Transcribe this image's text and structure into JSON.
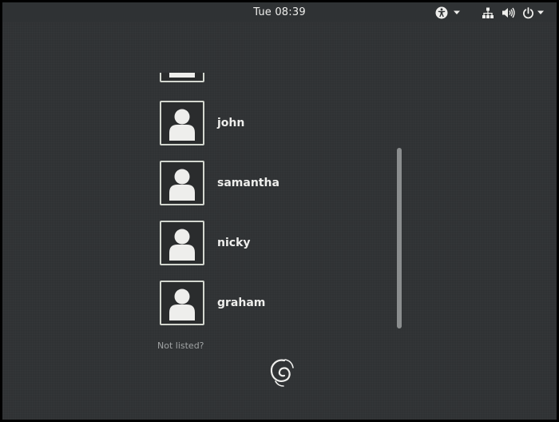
{
  "topbar": {
    "clock": "Tue 08:39",
    "accessibility_icon": "accessibility-icon",
    "dropdown_icon": "chevron-down-icon",
    "network_icon": "network-wired-icon",
    "volume_icon": "volume-icon",
    "power_icon": "power-icon"
  },
  "users": [
    {
      "name": ""
    },
    {
      "name": "john"
    },
    {
      "name": "samantha"
    },
    {
      "name": "nicky"
    },
    {
      "name": "graham"
    }
  ],
  "not_listed_label": "Not listed?",
  "logo": "debian-swirl-logo",
  "colors": {
    "background": "#2f3234",
    "text": "#eeeeec",
    "muted_text": "#a0a3a4",
    "avatar_border": "#d3d7cf",
    "scrollbar": "#8b8e8f"
  }
}
